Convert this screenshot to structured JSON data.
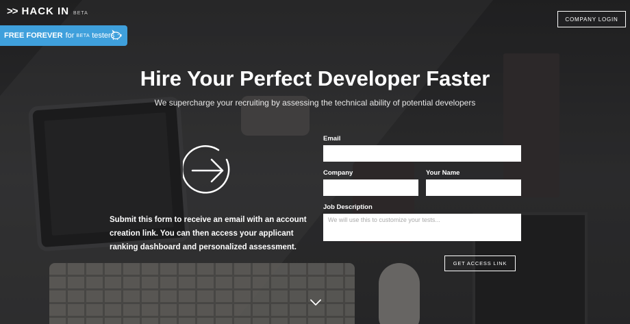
{
  "header": {
    "logo_arrows": ">>",
    "logo_text": "HACK IN",
    "logo_badge": "BETA",
    "login_button": "COMPANY LOGIN"
  },
  "promo": {
    "strong": "FREE FOREVER",
    "for": "for",
    "beta": "BETA",
    "testers": "testers",
    "icon": "piggy-bank-icon",
    "color": "#3fa0dc"
  },
  "hero": {
    "title": "Hire Your Perfect Developer Faster",
    "subtitle": "We supercharge your recruiting by assessing the technical ability of potential developers"
  },
  "info": {
    "icon": "arrow-right-circle-icon",
    "text": "Submit this form to receive an email with an account creation link. You can then access your applicant ranking dashboard and personalized assessment."
  },
  "form": {
    "email_label": "Email",
    "email_value": "",
    "company_label": "Company",
    "company_value": "",
    "name_label": "Your Name",
    "name_value": "",
    "job_label": "Job Description",
    "job_placeholder": "We will use this to customize your tests...",
    "submit_label": "GET ACCESS LINK"
  },
  "scroll_icon": "chevron-down-icon"
}
